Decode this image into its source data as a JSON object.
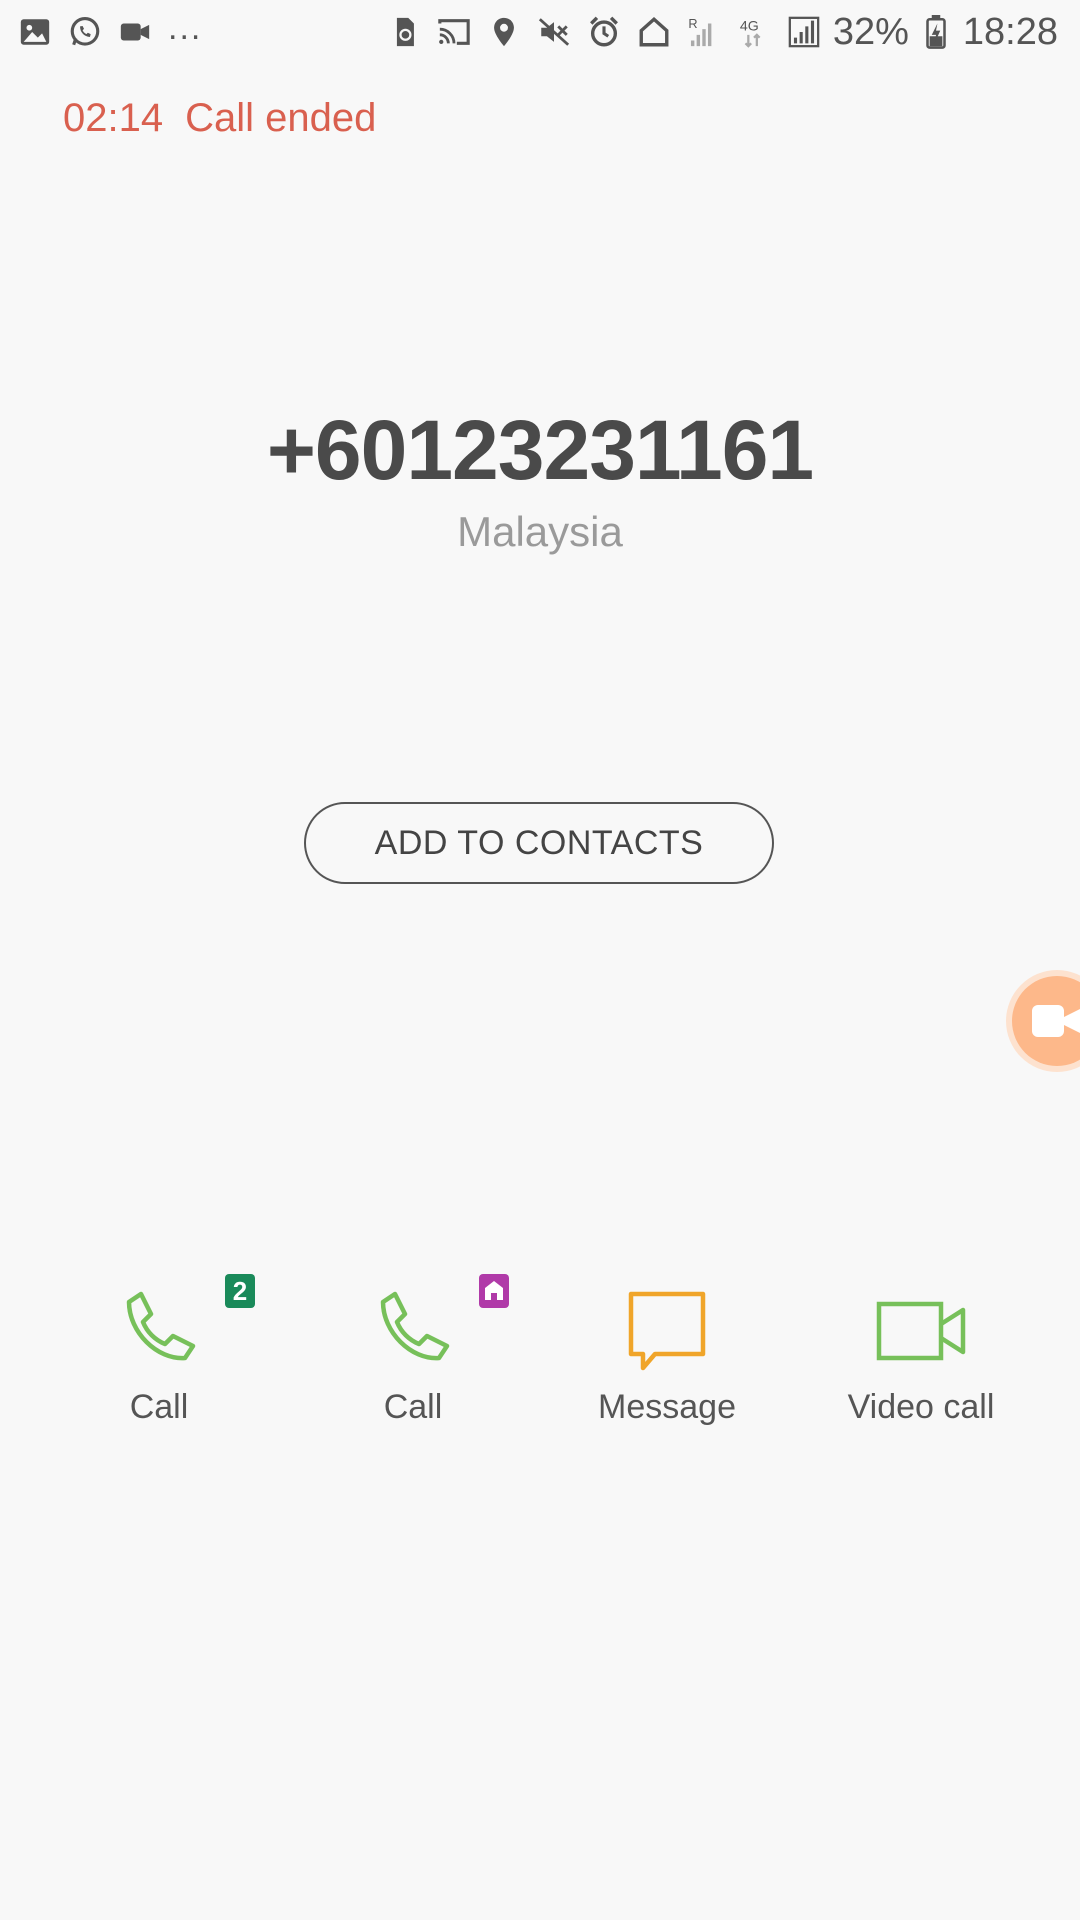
{
  "status_bar": {
    "left_icons": [
      "image-icon",
      "whatsapp-icon",
      "video-camera-icon"
    ],
    "more_indicator": "...",
    "right_icons": [
      "sim-recycle-icon",
      "cast-icon",
      "location-icon",
      "mute-icon",
      "alarm-icon",
      "home-icon",
      "signal-roaming-icon",
      "4g-icon",
      "signal-icon"
    ],
    "battery_percent": "32%",
    "time": "18:28"
  },
  "call": {
    "duration": "02:14",
    "status": "Call ended"
  },
  "contact": {
    "number": "+60123231161",
    "country": "Malaysia"
  },
  "add_contacts_label": "ADD TO CONTACTS",
  "actions": [
    {
      "label": "Call",
      "icon": "phone-icon",
      "badge": "2",
      "badge_color": "#1a8a5a",
      "color": "#77c05a"
    },
    {
      "label": "Call",
      "icon": "phone-icon",
      "badge_icon": "home-icon",
      "badge_color": "#b03aa8",
      "color": "#77c05a"
    },
    {
      "label": "Message",
      "icon": "message-icon",
      "color": "#f0a52a"
    },
    {
      "label": "Video call",
      "icon": "video-call-icon",
      "color": "#77c05a"
    }
  ],
  "floating_bubble": {
    "icon": "video-camera-icon",
    "color": "#fdb88a"
  }
}
